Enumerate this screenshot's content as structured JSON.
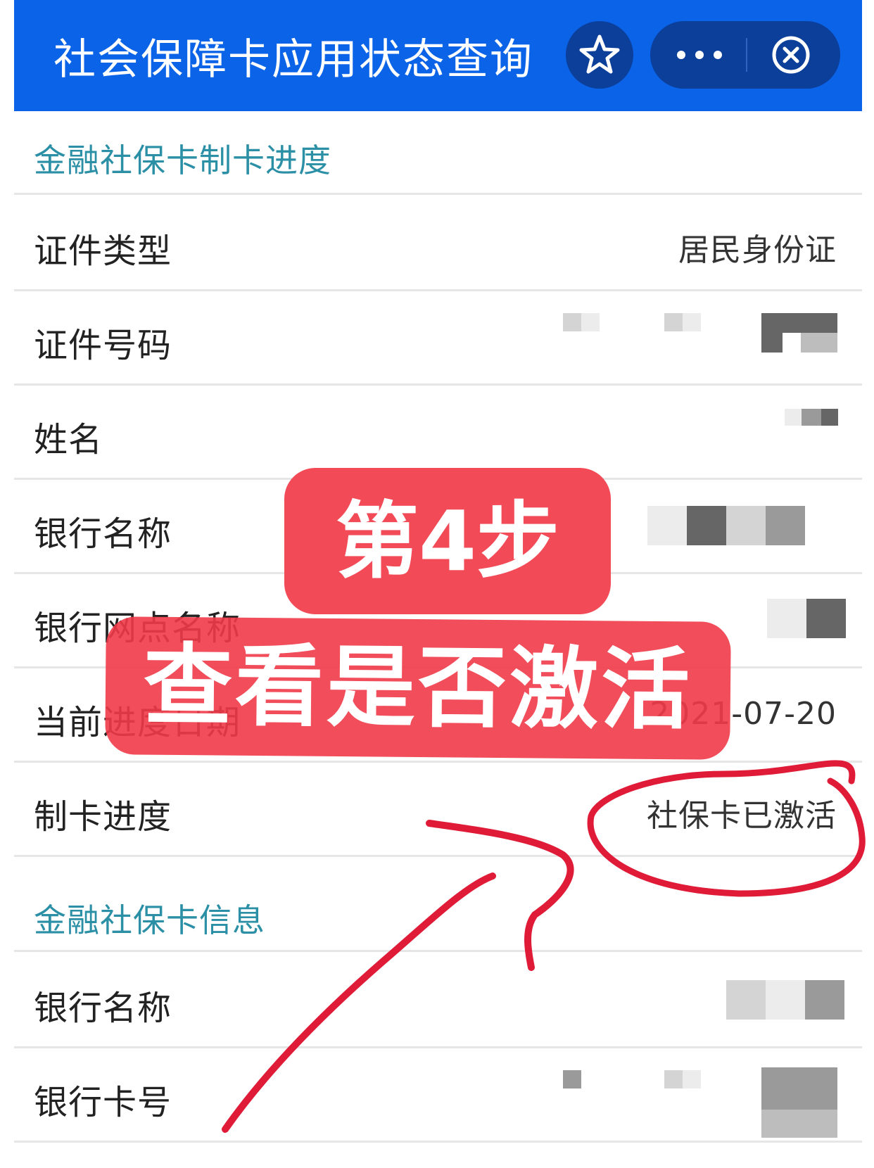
{
  "header": {
    "title": "社会保障卡应用状态查询",
    "star_icon": "star-outline-icon",
    "more_icon": "more-dots-icon",
    "close_icon": "close-circle-icon",
    "color": "#0b63e8"
  },
  "progress_section": {
    "title": "金融社保卡制卡进度",
    "rows": [
      {
        "label": "证件类型",
        "value": "居民身份证"
      },
      {
        "label": "证件号码",
        "value": ""
      },
      {
        "label": "姓名",
        "value": ""
      },
      {
        "label": "银行名称",
        "value": ""
      },
      {
        "label": "银行网点名称",
        "value": ""
      },
      {
        "label": "当前进度日期",
        "value": "2021-07-20"
      },
      {
        "label": "制卡进度",
        "value": "社保卡已激活"
      }
    ]
  },
  "info_section": {
    "title": "金融社保卡信息",
    "rows": [
      {
        "label": "银行名称",
        "value": ""
      },
      {
        "label": "银行卡号",
        "value": ""
      }
    ]
  },
  "annotations": {
    "step_label": "第4步",
    "instruction": "查看是否激活",
    "highlight_color": "#f24a57"
  }
}
